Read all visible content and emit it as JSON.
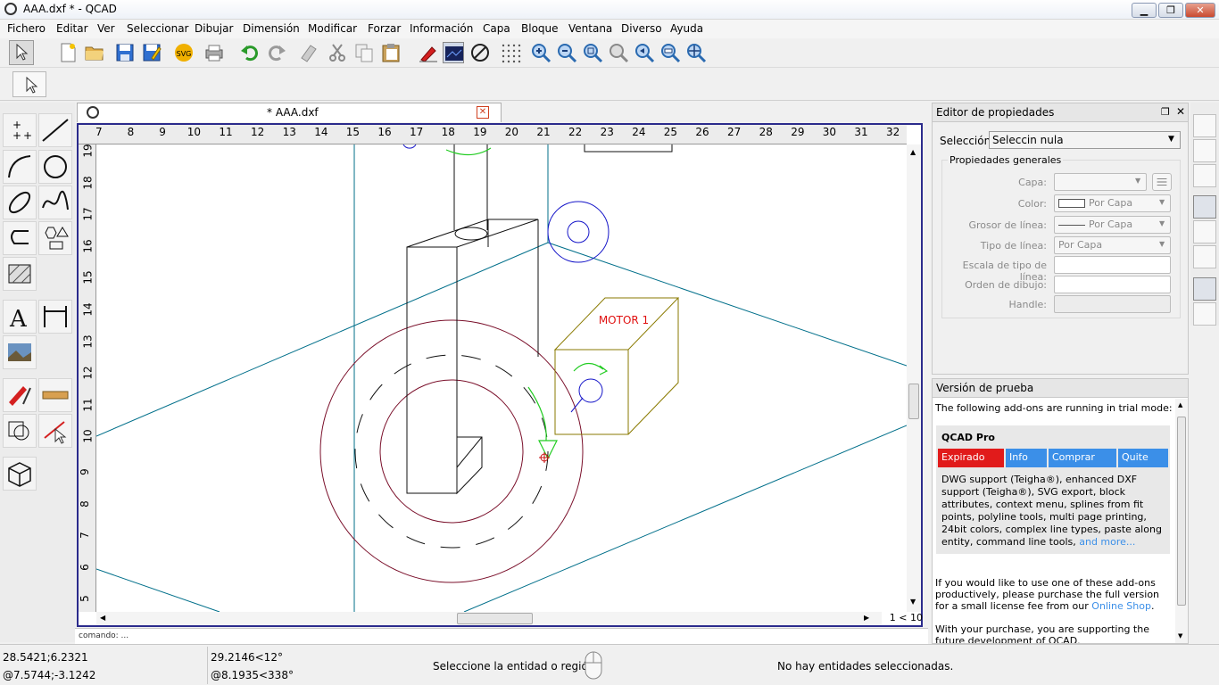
{
  "window": {
    "title": "AAA.dxf * - QCAD",
    "btn_min": "▁",
    "btn_max": "❐",
    "btn_close": "✕"
  },
  "menu": [
    "Fichero",
    "Editar",
    "Ver",
    "Seleccionar",
    "Dibujar",
    "Dimensión",
    "Modificar",
    "Forzar",
    "Información",
    "Capa",
    "Bloque",
    "Ventana",
    "Diverso",
    "Ayuda"
  ],
  "document": {
    "tab_title": "* AAA.dxf",
    "zoom": "1 < 10"
  },
  "ruler": {
    "top": [
      "7",
      "8",
      "9",
      "10",
      "11",
      "12",
      "13",
      "14",
      "15",
      "16",
      "17",
      "18",
      "19",
      "20",
      "21",
      "22",
      "23",
      "24",
      "25",
      "26",
      "27",
      "28",
      "29",
      "30",
      "31",
      "32"
    ],
    "left": [
      "19",
      "18",
      "17",
      "16",
      "15",
      "14",
      "13",
      "12",
      "11",
      "10",
      "9",
      "8",
      "7",
      "6",
      "5"
    ]
  },
  "drawing": {
    "motor_label": "MOTOR 1",
    "colors": {
      "teal": "#006f8a",
      "dark_red": "#7a0f2a",
      "blue": "#1414c8",
      "olive": "#8a7a00",
      "green": "#22cc22",
      "label_red": "#e01010"
    }
  },
  "command_line": {
    "text": "comando: ..."
  },
  "status": {
    "abs_coord": "28.5421;6.2321",
    "rel_coord": "@7.5744;-3.1242",
    "polar_coord": "29.2146<12°",
    "rel_polar": "@8.1935<338°",
    "prompt": "Seleccione la entidad o región",
    "selection": "No hay entidades seleccionadas."
  },
  "properties": {
    "title": "Editor de propiedades",
    "selection_label": "Selección:",
    "selection_value": "Seleccin nula",
    "group_title": "Propiedades generales",
    "rows": [
      {
        "label": "Capa:",
        "value": ""
      },
      {
        "label": "Color:",
        "value": "Por Capa"
      },
      {
        "label": "Grosor de línea:",
        "value": "Por Capa"
      },
      {
        "label": "Tipo de línea:",
        "value": "Por Capa"
      },
      {
        "label": "Escala de tipo de línea:",
        "value": ""
      },
      {
        "label": "Orden de dibujo:",
        "value": ""
      },
      {
        "label": "Handle:",
        "value": ""
      }
    ]
  },
  "trial": {
    "title": "Versión de prueba",
    "intro": "The following add-ons are running in trial mode:",
    "product": "QCAD Pro",
    "buttons": [
      {
        "label": "Expirado",
        "color": "#e11b1b"
      },
      {
        "label": "Info",
        "color": "#3b8fe8"
      },
      {
        "label": "Comprar",
        "color": "#3b8fe8"
      },
      {
        "label": "Quite",
        "color": "#3b8fe8"
      }
    ],
    "description": "DWG support (Teigha®), enhanced DXF support (Teigha®), SVG export, block attributes, context menu, splines from fit points, polyline tools, multi page printing, 24bit colors, complex line types, paste along entity, command line tools,",
    "more_link": "and more...",
    "purchase_text": "If you would like to use one of these add-ons productively, please purchase the full version for a small license fee from our",
    "shop_link": "Online Shop",
    "support_text": "With your purchase, you are supporting the future development of QCAD."
  }
}
